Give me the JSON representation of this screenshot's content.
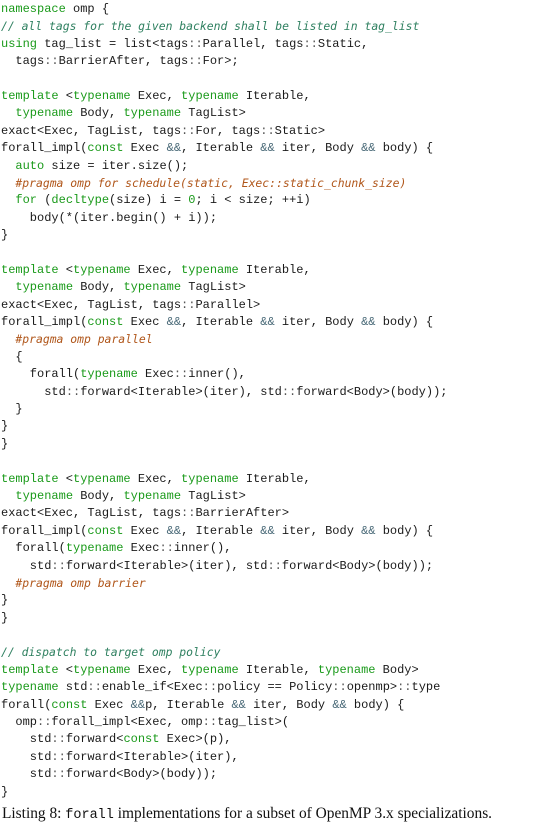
{
  "listing": {
    "lines": [
      [
        {
          "t": "namespace",
          "c": "kw"
        },
        {
          "t": " omp {",
          "c": ""
        }
      ],
      [
        {
          "t": "// all tags for the given backend shall be listed in tag_list",
          "c": "cm"
        }
      ],
      [
        {
          "t": "using",
          "c": "kw"
        },
        {
          "t": " tag_list = list<tags",
          "c": ""
        },
        {
          "t": "::",
          "c": "sc"
        },
        {
          "t": "Parallel, tags",
          "c": ""
        },
        {
          "t": "::",
          "c": "sc"
        },
        {
          "t": "Static,",
          "c": ""
        }
      ],
      [
        {
          "t": "  tags",
          "c": ""
        },
        {
          "t": "::",
          "c": "sc"
        },
        {
          "t": "BarrierAfter, tags",
          "c": ""
        },
        {
          "t": "::",
          "c": "sc"
        },
        {
          "t": "For>;",
          "c": ""
        }
      ],
      [],
      [
        {
          "t": "template",
          "c": "kw"
        },
        {
          "t": " <",
          "c": ""
        },
        {
          "t": "typename",
          "c": "kw"
        },
        {
          "t": " Exec, ",
          "c": ""
        },
        {
          "t": "typename",
          "c": "kw"
        },
        {
          "t": " Iterable,",
          "c": ""
        }
      ],
      [
        {
          "t": "  ",
          "c": ""
        },
        {
          "t": "typename",
          "c": "kw"
        },
        {
          "t": " Body, ",
          "c": ""
        },
        {
          "t": "typename",
          "c": "kw"
        },
        {
          "t": " TagList>",
          "c": ""
        }
      ],
      [
        {
          "t": "exact<Exec, TagList, tags",
          "c": ""
        },
        {
          "t": "::",
          "c": "sc"
        },
        {
          "t": "For, tags",
          "c": ""
        },
        {
          "t": "::",
          "c": "sc"
        },
        {
          "t": "Static>",
          "c": ""
        }
      ],
      [
        {
          "t": "forall_impl(",
          "c": ""
        },
        {
          "t": "const",
          "c": "kw"
        },
        {
          "t": " Exec ",
          "c": ""
        },
        {
          "t": "&&",
          "c": "op"
        },
        {
          "t": ", Iterable ",
          "c": ""
        },
        {
          "t": "&&",
          "c": "op"
        },
        {
          "t": " iter, Body ",
          "c": ""
        },
        {
          "t": "&&",
          "c": "op"
        },
        {
          "t": " body) {",
          "c": ""
        }
      ],
      [
        {
          "t": "  ",
          "c": ""
        },
        {
          "t": "auto",
          "c": "kw"
        },
        {
          "t": " size = iter.size();",
          "c": ""
        }
      ],
      [
        {
          "t": "  ",
          "c": ""
        },
        {
          "t": "#pragma omp for schedule(static, Exec::static_chunk_size)",
          "c": "pp"
        }
      ],
      [
        {
          "t": "  ",
          "c": ""
        },
        {
          "t": "for",
          "c": "kw"
        },
        {
          "t": " (",
          "c": ""
        },
        {
          "t": "decltype",
          "c": "kw"
        },
        {
          "t": "(size) i = ",
          "c": ""
        },
        {
          "t": "0",
          "c": "num"
        },
        {
          "t": "; i < size; ++i)",
          "c": ""
        }
      ],
      [
        {
          "t": "    body(*(iter.begin() + i));",
          "c": ""
        }
      ],
      [
        {
          "t": "}",
          "c": ""
        }
      ],
      [],
      [
        {
          "t": "template",
          "c": "kw"
        },
        {
          "t": " <",
          "c": ""
        },
        {
          "t": "typename",
          "c": "kw"
        },
        {
          "t": " Exec, ",
          "c": ""
        },
        {
          "t": "typename",
          "c": "kw"
        },
        {
          "t": " Iterable,",
          "c": ""
        }
      ],
      [
        {
          "t": "  ",
          "c": ""
        },
        {
          "t": "typename",
          "c": "kw"
        },
        {
          "t": " Body, ",
          "c": ""
        },
        {
          "t": "typename",
          "c": "kw"
        },
        {
          "t": " TagList>",
          "c": ""
        }
      ],
      [
        {
          "t": "exact<Exec, TagList, tags",
          "c": ""
        },
        {
          "t": "::",
          "c": "sc"
        },
        {
          "t": "Parallel>",
          "c": ""
        }
      ],
      [
        {
          "t": "forall_impl(",
          "c": ""
        },
        {
          "t": "const",
          "c": "kw"
        },
        {
          "t": " Exec ",
          "c": ""
        },
        {
          "t": "&&",
          "c": "op"
        },
        {
          "t": ", Iterable ",
          "c": ""
        },
        {
          "t": "&&",
          "c": "op"
        },
        {
          "t": " iter, Body ",
          "c": ""
        },
        {
          "t": "&&",
          "c": "op"
        },
        {
          "t": " body) {",
          "c": ""
        }
      ],
      [
        {
          "t": "  ",
          "c": ""
        },
        {
          "t": "#pragma omp parallel",
          "c": "pp"
        }
      ],
      [
        {
          "t": "  {",
          "c": ""
        }
      ],
      [
        {
          "t": "    forall(",
          "c": ""
        },
        {
          "t": "typename",
          "c": "kw"
        },
        {
          "t": " Exec",
          "c": ""
        },
        {
          "t": "::",
          "c": "sc"
        },
        {
          "t": "inner(),",
          "c": ""
        }
      ],
      [
        {
          "t": "      std",
          "c": ""
        },
        {
          "t": "::",
          "c": "sc"
        },
        {
          "t": "forward<Iterable>(iter), std",
          "c": ""
        },
        {
          "t": "::",
          "c": "sc"
        },
        {
          "t": "forward<Body>(body));",
          "c": ""
        }
      ],
      [
        {
          "t": "  }",
          "c": ""
        }
      ],
      [
        {
          "t": "}",
          "c": ""
        }
      ],
      [
        {
          "t": "}",
          "c": ""
        }
      ],
      [],
      [
        {
          "t": "template",
          "c": "kw"
        },
        {
          "t": " <",
          "c": ""
        },
        {
          "t": "typename",
          "c": "kw"
        },
        {
          "t": " Exec, ",
          "c": ""
        },
        {
          "t": "typename",
          "c": "kw"
        },
        {
          "t": " Iterable,",
          "c": ""
        }
      ],
      [
        {
          "t": "  ",
          "c": ""
        },
        {
          "t": "typename",
          "c": "kw"
        },
        {
          "t": " Body, ",
          "c": ""
        },
        {
          "t": "typename",
          "c": "kw"
        },
        {
          "t": " TagList>",
          "c": ""
        }
      ],
      [
        {
          "t": "exact<Exec, TagList, tags",
          "c": ""
        },
        {
          "t": "::",
          "c": "sc"
        },
        {
          "t": "BarrierAfter>",
          "c": ""
        }
      ],
      [
        {
          "t": "forall_impl(",
          "c": ""
        },
        {
          "t": "const",
          "c": "kw"
        },
        {
          "t": " Exec ",
          "c": ""
        },
        {
          "t": "&&",
          "c": "op"
        },
        {
          "t": ", Iterable ",
          "c": ""
        },
        {
          "t": "&&",
          "c": "op"
        },
        {
          "t": " iter, Body ",
          "c": ""
        },
        {
          "t": "&&",
          "c": "op"
        },
        {
          "t": " body) {",
          "c": ""
        }
      ],
      [
        {
          "t": "  forall(",
          "c": ""
        },
        {
          "t": "typename",
          "c": "kw"
        },
        {
          "t": " Exec",
          "c": ""
        },
        {
          "t": "::",
          "c": "sc"
        },
        {
          "t": "inner(),",
          "c": ""
        }
      ],
      [
        {
          "t": "    std",
          "c": ""
        },
        {
          "t": "::",
          "c": "sc"
        },
        {
          "t": "forward<Iterable>(iter), std",
          "c": ""
        },
        {
          "t": "::",
          "c": "sc"
        },
        {
          "t": "forward<Body>(body));",
          "c": ""
        }
      ],
      [
        {
          "t": "  ",
          "c": ""
        },
        {
          "t": "#pragma omp barrier",
          "c": "pp"
        }
      ],
      [
        {
          "t": "}",
          "c": ""
        }
      ],
      [
        {
          "t": "}",
          "c": ""
        }
      ],
      [],
      [
        {
          "t": "// dispatch to target omp policy",
          "c": "cm"
        }
      ],
      [
        {
          "t": "template",
          "c": "kw"
        },
        {
          "t": " <",
          "c": ""
        },
        {
          "t": "typename",
          "c": "kw"
        },
        {
          "t": " Exec, ",
          "c": ""
        },
        {
          "t": "typename",
          "c": "kw"
        },
        {
          "t": " Iterable, ",
          "c": ""
        },
        {
          "t": "typename",
          "c": "kw"
        },
        {
          "t": " Body>",
          "c": ""
        }
      ],
      [
        {
          "t": "typename",
          "c": "kw"
        },
        {
          "t": " std",
          "c": ""
        },
        {
          "t": "::",
          "c": "sc"
        },
        {
          "t": "enable_if<Exec",
          "c": ""
        },
        {
          "t": "::",
          "c": "sc"
        },
        {
          "t": "policy == Policy",
          "c": ""
        },
        {
          "t": "::",
          "c": "sc"
        },
        {
          "t": "openmp>",
          "c": ""
        },
        {
          "t": "::",
          "c": "sc"
        },
        {
          "t": "type",
          "c": ""
        }
      ],
      [
        {
          "t": "forall(",
          "c": ""
        },
        {
          "t": "const",
          "c": "kw"
        },
        {
          "t": " Exec ",
          "c": ""
        },
        {
          "t": "&&",
          "c": "op"
        },
        {
          "t": "p, Iterable ",
          "c": ""
        },
        {
          "t": "&&",
          "c": "op"
        },
        {
          "t": " iter, Body ",
          "c": ""
        },
        {
          "t": "&&",
          "c": "op"
        },
        {
          "t": " body) {",
          "c": ""
        }
      ],
      [
        {
          "t": "  omp",
          "c": ""
        },
        {
          "t": "::",
          "c": "sc"
        },
        {
          "t": "forall_impl<Exec, omp",
          "c": ""
        },
        {
          "t": "::",
          "c": "sc"
        },
        {
          "t": "tag_list>(",
          "c": ""
        }
      ],
      [
        {
          "t": "    std",
          "c": ""
        },
        {
          "t": "::",
          "c": "sc"
        },
        {
          "t": "forward<",
          "c": ""
        },
        {
          "t": "const",
          "c": "kw"
        },
        {
          "t": " Exec>(p),",
          "c": ""
        }
      ],
      [
        {
          "t": "    std",
          "c": ""
        },
        {
          "t": "::",
          "c": "sc"
        },
        {
          "t": "forward<Iterable>(iter),",
          "c": ""
        }
      ],
      [
        {
          "t": "    std",
          "c": ""
        },
        {
          "t": "::",
          "c": "sc"
        },
        {
          "t": "forward<Body>(body));",
          "c": ""
        }
      ],
      [
        {
          "t": "}",
          "c": ""
        }
      ]
    ]
  },
  "caption": {
    "prefix": "Listing 8: ",
    "code": "forall",
    "suffix": " implementations for a subset of OpenMP 3.x specializations."
  },
  "colors": {
    "keyword": "#1a9a1a",
    "comment": "#2f8060",
    "pragma": "#b0561a",
    "operator": "#4a6a78",
    "text": "#1a1a1a"
  }
}
